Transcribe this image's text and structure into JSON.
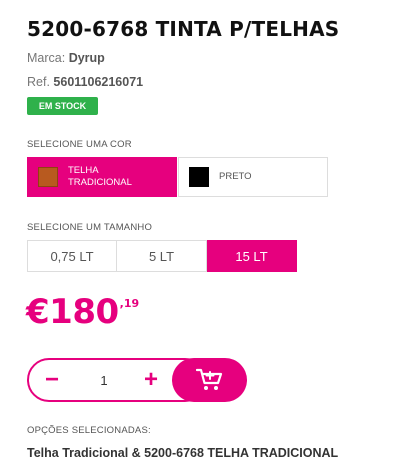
{
  "product": {
    "title": "5200-6768 TINTA P/TELHAS",
    "brand_label": "Marca:",
    "brand": "Dyrup",
    "ref_label": "Ref.",
    "ref": "5601106216071",
    "stock_badge": "EM STOCK"
  },
  "color_selector": {
    "label": "SELECIONE UMA COR",
    "options": [
      {
        "label": "TELHA TRADICIONAL",
        "swatch": "#b85a1f",
        "selected": true
      },
      {
        "label": "PRETO",
        "swatch": "#000000",
        "selected": false
      }
    ]
  },
  "size_selector": {
    "label": "SELECIONE UM TAMANHO",
    "options": [
      {
        "label": "0,75 LT",
        "selected": false
      },
      {
        "label": "5 LT",
        "selected": false
      },
      {
        "label": "15 LT",
        "selected": true
      }
    ]
  },
  "price": {
    "main": "€180",
    "cents": ",19"
  },
  "quantity": {
    "minus": "−",
    "value": "1",
    "plus": "+",
    "cart_icon": "cart-plus-icon"
  },
  "selected_options": {
    "label": "OPÇÕES SELECIONADAS:",
    "value": "Telha Tradicional & 5200-6768 TELHA TRADICIONAL"
  },
  "colors": {
    "accent": "#e6007e",
    "stock_green": "#2fb14b"
  }
}
